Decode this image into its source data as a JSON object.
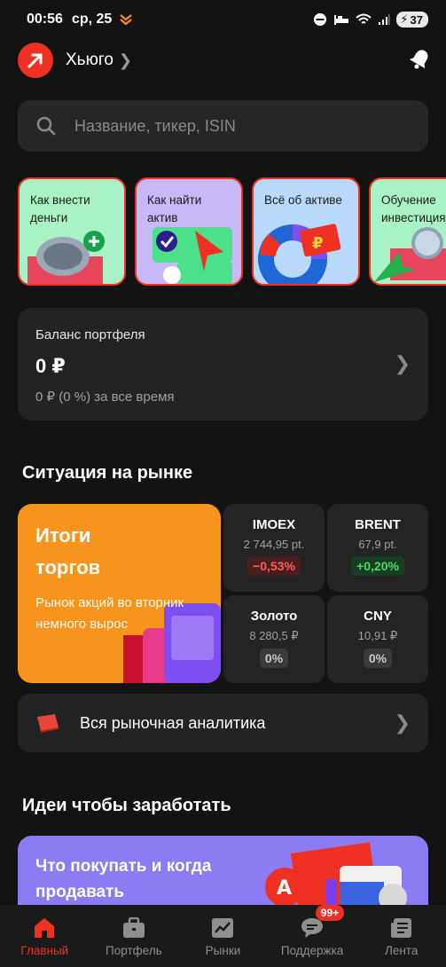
{
  "status": {
    "time": "00:56",
    "date": "ср, 25",
    "battery": "37"
  },
  "header": {
    "username": "Хьюго"
  },
  "search": {
    "placeholder": "Название, тикер, ISIN"
  },
  "stories": [
    {
      "label": "Как внести деньги"
    },
    {
      "label": "Как найти актив"
    },
    {
      "label": "Всё об активе"
    },
    {
      "label": "Обучение инвестиция"
    }
  ],
  "balance": {
    "title": "Баланс портфеля",
    "value": "0 ₽",
    "sub": "0 ₽ (0 %) за все время"
  },
  "market": {
    "section_title": "Ситуация на рынке",
    "summary_title": "Итоги торгов",
    "summary_desc": "Рынок акций во вторник немного вырос",
    "tiles": [
      {
        "name": "IMOEX",
        "value": "2 744,95 pt.",
        "change": "−0,53%",
        "trend": "neg"
      },
      {
        "name": "BRENT",
        "value": "67,9 pt.",
        "change": "+0,20%",
        "trend": "pos"
      },
      {
        "name": "Золото",
        "value": "8 280,5 ₽",
        "change": "0%",
        "trend": "neu"
      },
      {
        "name": "CNY",
        "value": "10,91 ₽",
        "change": "0%",
        "trend": "neu"
      }
    ],
    "analytics_label": "Вся рыночная аналитика"
  },
  "ideas": {
    "section_title": "Идеи чтобы заработать",
    "card_label": "Что покупать и когда продавать"
  },
  "nav": {
    "items": [
      {
        "label": "Главный"
      },
      {
        "label": "Портфель"
      },
      {
        "label": "Рынки"
      },
      {
        "label": "Поддержка",
        "badge": "99+"
      },
      {
        "label": "Лента"
      }
    ]
  },
  "colors": {
    "accent": "#ef3124",
    "background": "#131313",
    "card": "#232323",
    "summary": "#f7941d",
    "idea": "#8b7cf3"
  }
}
